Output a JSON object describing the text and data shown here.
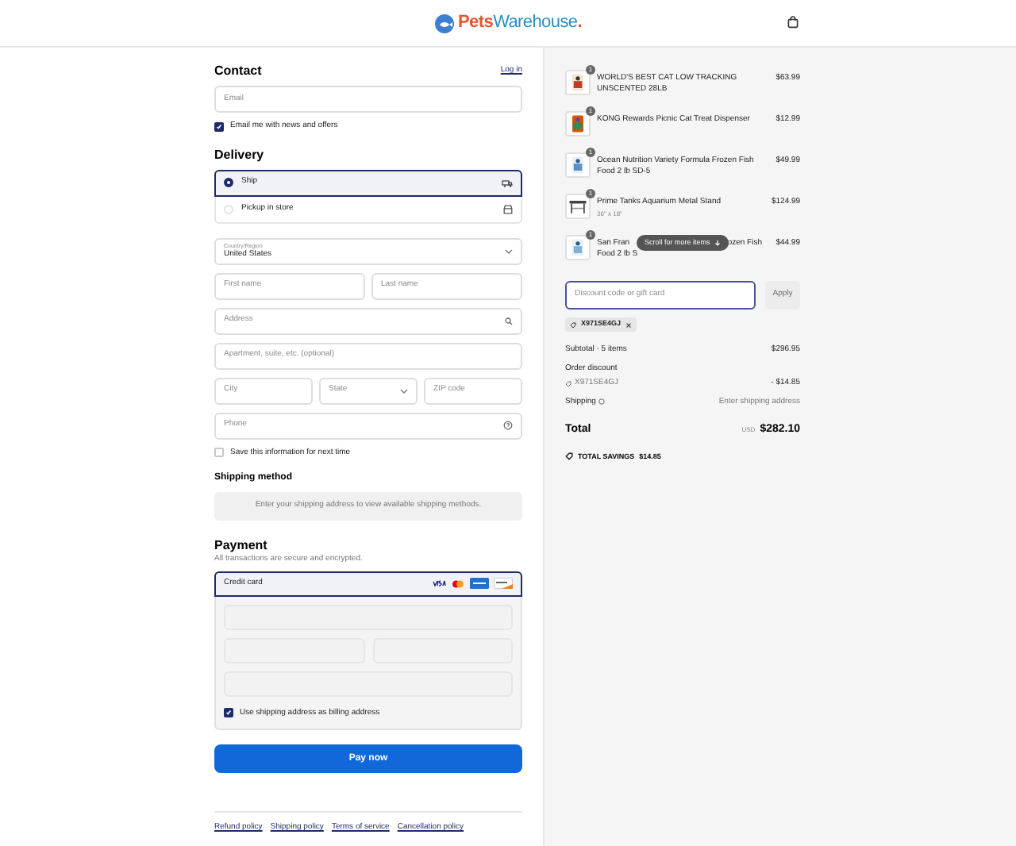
{
  "header": {
    "logo_first": "Pets",
    "logo_second": "Warehouse",
    "logo_dot": "."
  },
  "contact": {
    "title": "Contact",
    "login_link": "Log in",
    "email_placeholder": "Email",
    "news": {
      "label": "Email me with news and offers",
      "checked": true
    }
  },
  "delivery": {
    "title": "Delivery",
    "options": [
      {
        "label": "Ship",
        "selected": true,
        "kind": "truck"
      },
      {
        "label": "Pickup in store",
        "selected": false,
        "kind": "store"
      }
    ],
    "country": {
      "label": "Country/Region",
      "value": "United States"
    },
    "first_name": "First name",
    "last_name": "Last name",
    "address": "Address",
    "apartment": "Apartment, suite, etc. (optional)",
    "city": "City",
    "state": "State",
    "zip": "ZIP code",
    "phone": "Phone",
    "save": {
      "label": "Save this information for next time",
      "checked": false
    }
  },
  "shipping_method": {
    "title": "Shipping method",
    "note": "Enter your shipping address to view available shipping methods."
  },
  "payment": {
    "title": "Payment",
    "subtitle": "All transactions are secure and encrypted.",
    "method": "Credit card",
    "billing": {
      "label": "Use shipping address as billing address",
      "checked": true
    },
    "pay_button": "Pay now"
  },
  "footer_links": [
    "Refund policy",
    "Shipping policy",
    "Terms of service",
    "Cancellation policy"
  ],
  "cart": {
    "items": [
      {
        "qty": "1",
        "name": "WORLD'S BEST CAT LOW TRACKING UNSCENTED 28LB",
        "price": "$63.99"
      },
      {
        "qty": "1",
        "name": "KONG Rewards Picnic Cat Treat Dispenser",
        "price": "$12.99"
      },
      {
        "qty": "1",
        "name": "Ocean Nutrition Variety Formula Frozen Fish Food 2 lb SD-5",
        "price": "$49.99"
      },
      {
        "qty": "1",
        "name": "Prime Tanks Aquarium Metal Stand",
        "variant": "36\" x 18\"",
        "price": "$124.99"
      },
      {
        "qty": "1",
        "name_before": "San Fran",
        "name_after": "ozen Fish",
        "name_line2": "Food 2 lb S",
        "price": "$44.99"
      }
    ],
    "scroll_hint": "Scroll for more items",
    "discount_placeholder": "Discount code or gift card",
    "apply": "Apply",
    "applied_code": "X971SE4GJ",
    "subtotal_label": "Subtotal · 5 items",
    "subtotal": "$296.95",
    "order_discount_label": "Order discount",
    "discount_code": "X971SE4GJ",
    "discount_value": "- $14.85",
    "shipping_label": "Shipping",
    "shipping_value": "Enter shipping address",
    "total_label": "Total",
    "currency": "USD",
    "total": "$282.10",
    "savings_label": "TOTAL SAVINGS",
    "savings": "$14.85"
  }
}
